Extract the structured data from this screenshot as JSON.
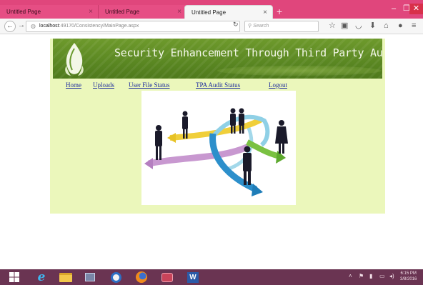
{
  "browser": {
    "tabs": [
      {
        "title": "Untitled Page",
        "active": false
      },
      {
        "title": "Untitled Page",
        "active": false
      },
      {
        "title": "Untitled Page",
        "active": true
      }
    ],
    "tab_close_glyph": "×",
    "new_tab_glyph": "+",
    "address": {
      "host": "localhost",
      "rest": ":49170/Consistency/MainPage.aspx"
    },
    "search_placeholder": "Search",
    "accent_color": "#e0467c"
  },
  "site": {
    "banner_title": "Security Enhancement Through Third Party Auditing",
    "nav": [
      "Home",
      "Uploads",
      "User File Status",
      "TPA Audit Status",
      "Logout"
    ],
    "background_color": "#ebf7bb",
    "banner_color": "#5a8722"
  },
  "taskbar": {
    "time": "6:15 PM",
    "date": "3/8/2016",
    "color": "#6a3452"
  }
}
